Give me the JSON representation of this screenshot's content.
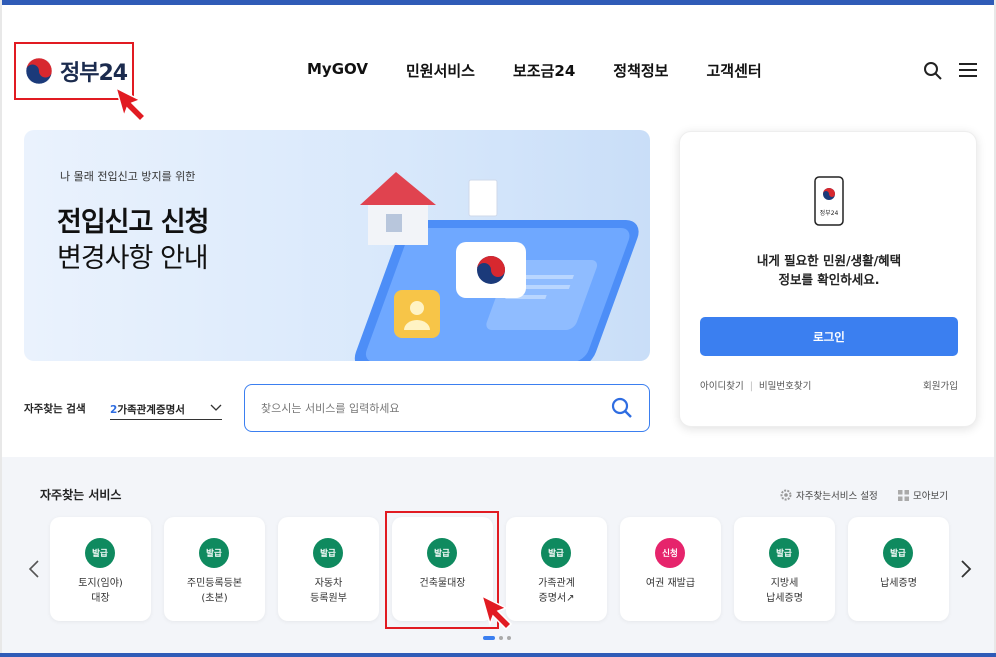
{
  "header": {
    "logo_text": "정부24",
    "nav": [
      "MyGOV",
      "민원서비스",
      "보조금24",
      "정책정보",
      "고객센터"
    ]
  },
  "banner": {
    "kicker": "나 몰래 전입신고 방지를 위한",
    "title": "전입신고 신청",
    "subtitle": "변경사항 안내"
  },
  "login": {
    "app_label": "정부24",
    "message_line1": "내게 필요한 민원/생활/혜택",
    "message_line2": "정보를 확인하세요.",
    "button": "로그인",
    "find_id": "아이디찾기",
    "find_pw": "비밀번호찾기",
    "signup": "회원가입"
  },
  "search": {
    "freq_label": "자주찾는 검색",
    "selected_num": "2",
    "selected_text": "가족관계증명서",
    "placeholder": "찾으시는 서비스를 입력하세요"
  },
  "services": {
    "title": "자주찾는 서비스",
    "settings_label": "자주찾는서비스 설정",
    "view_all_label": "모아보기",
    "items": [
      {
        "badge": "발급",
        "name": "토지(임야)\n대장",
        "color": "#0f8a5f"
      },
      {
        "badge": "발급",
        "name": "주민등록등본\n(초본)",
        "color": "#0f8a5f"
      },
      {
        "badge": "발급",
        "name": "자동차\n등록원부",
        "color": "#0f8a5f"
      },
      {
        "badge": "발급",
        "name": "건축물대장",
        "color": "#0f8a5f"
      },
      {
        "badge": "발급",
        "name": "가족관계\n증명서↗",
        "color": "#0f8a5f"
      },
      {
        "badge": "신청",
        "name": "여권 재발급",
        "color": "#e6246c"
      },
      {
        "badge": "발급",
        "name": "지방세\n납세증명",
        "color": "#0f8a5f"
      },
      {
        "badge": "발급",
        "name": "납세증명",
        "color": "#0f8a5f"
      }
    ]
  },
  "colors": {
    "primary": "#3b7ff0",
    "brand_navy": "#1b2b4e",
    "highlight_red": "#e11b22"
  }
}
